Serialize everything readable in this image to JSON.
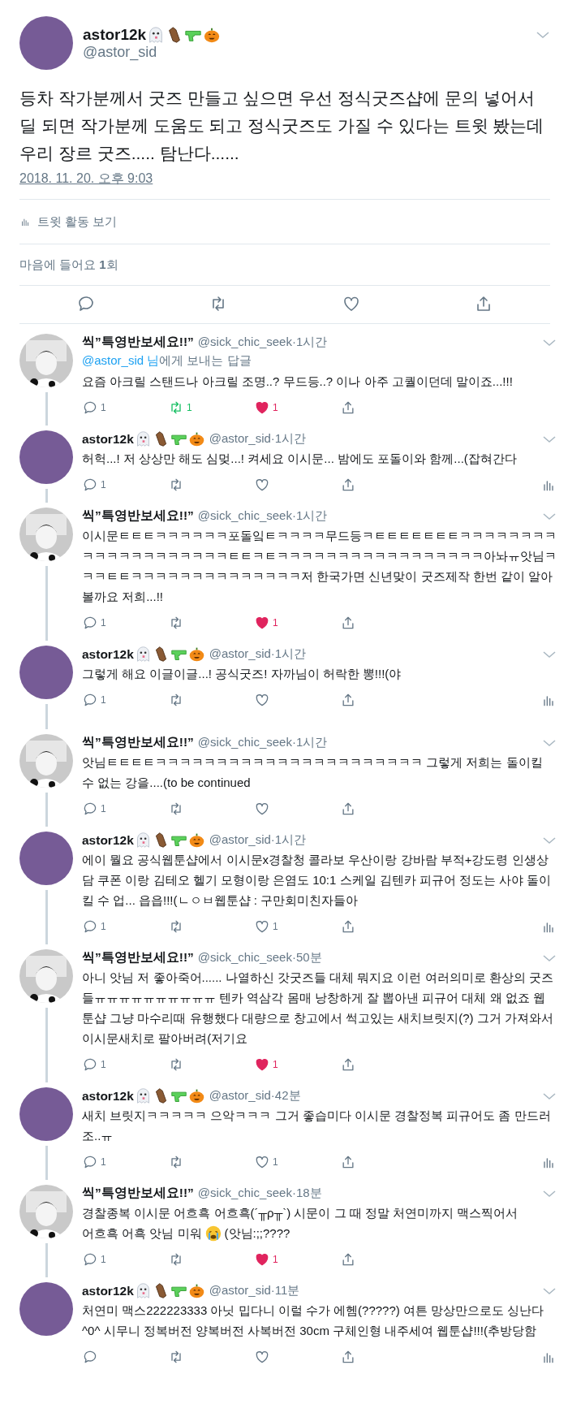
{
  "main_tweet": {
    "name": "astor12k",
    "handle": "@astor_sid",
    "text": "등차 작가분께서 굿즈 만들고 싶으면 우선 정식굿즈샵에 문의 넣어서 딜 되면 작가분께 도움도 되고 정식굿즈도 가질 수 있다는 트윗 봤는데 우리 장르 굿즈..... 탐난다......",
    "timestamp": "2018. 11. 20. 오후 9:03",
    "activity": "트윗 활동 보기",
    "likes": "마음에 들어요 **1**회"
  },
  "replies": [
    {
      "kind": "other",
      "name": "씩”특영반보세요!!”",
      "handle": "@sick_chic_seek",
      "time": "·1시간",
      "reply_to": {
        "link": "@astor_sid 님",
        "text": "에게 보내는 답글"
      },
      "body": "요즘 아크릴 스탠드나 아크릴 조명..? 무드등..? 이나 아주 고퀄이던데 말이죠...!!!",
      "replies": "1",
      "retweets": "1",
      "retweeted": true,
      "likes": "1",
      "liked": true
    },
    {
      "kind": "self",
      "name": "astor12k",
      "handle": "@astor_sid",
      "time": "·1시간",
      "body": "허헉...! 저 상상만 해도 심멎...! 켜세요 이시문... 밤에도 포돌이와 함께...(잡혀간다",
      "replies": "1",
      "retweeted": false,
      "liked": false
    },
    {
      "kind": "other",
      "name": "씩”특영반보세요!!”",
      "handle": "@sick_chic_seek",
      "time": "·1시간",
      "body": "이시문ㅌㅌㅌㅋㅋㅋㅋㅋㅋ포돌잌ㅌㅋㅋㅋㅋ무드등ㅋㅌㅌㅌㅌㅌㅌㅌㅋㅋㅋㅋㅋㅋㅋㅋㅋㅋㅋㅋㅋㅋㅋㅋㅋㅋㅋㅋㅌㅌㅋㅌㅋㅋㅋㅋㅋㅋㅋㅋㅋㅋㅋㅋㅋㅋㅋㅋㅋ아놔ㅠ앗님ㅋㅋㅋㅌㅌㅋㅋㅋㅋㅋㅋㅋㅋㅋㅋㅋㅋㅋㅋ저 한국가면 신년맞이 굿즈제작 한번 같이 알아볼까요 저희...!!",
      "replies": "1",
      "retweeted": false,
      "likes": "1",
      "liked": true
    },
    {
      "kind": "self",
      "name": "astor12k",
      "handle": "@astor_sid",
      "time": "·1시간",
      "body": "그렇게 해요 이글이글...! 공식굿즈! 자까님이 허락한 뽕!!!(야",
      "replies": "1",
      "retweeted": false,
      "liked": false
    },
    {
      "kind": "other",
      "name": "씩”특영반보세요!!”",
      "handle": "@sick_chic_seek",
      "time": "·1시간",
      "body": "앗님ㅌㅌㅌㅌㅋㅋㅋㅋㅋㅋㅋㅋㅋㅋㅋㅋㅋㅋㅋㅋㅋㅋㅋㅋㅋㅋ 그렇게 저희는 돌이킬 수 없는 강을....(to be continued",
      "replies": "1",
      "retweeted": false,
      "liked": false
    },
    {
      "kind": "self",
      "name": "astor12k",
      "handle": "@astor_sid",
      "time": "·1시간",
      "body": "에이 뭘요 공식웹툰샵에서 이시문x경찰청 콜라보 우산이랑 강바람 부적+강도령 인생상담 쿠폰 이랑 김테오 헬기 모형이랑 은염도 10:1 스케일 김텐카 피규어 정도는 사야 돌이킬 수 업... 읍읍!!!(ㄴㅇㅂ웹툰샵 : 구만회미친자들아",
      "replies": "1",
      "retweeted": false,
      "likes": "1",
      "liked": false
    },
    {
      "kind": "other",
      "name": "씩”특영반보세요!!”",
      "handle": "@sick_chic_seek",
      "time": "·50분",
      "body": "아니 앗님 저 좋아죽어...... 나열하신 갓굿즈들 대체 뭐지요 이런 여러의미로 환상의 굿즈들ㅠㅠㅠㅠㅠㅠㅠㅠㅠㅠ 텐카 역삼각 몸매 낭창하게 잘 뽑아낸 피규어 대체 왜 없죠 웹툰샵 그냥 마수리때 유행했다 대량으로 창고에서 썩고있는 새치브릿지(?) 그거 가져와서 이시문새치로 팔아버려(저기요",
      "replies": "1",
      "retweeted": false,
      "likes": "1",
      "liked": true
    },
    {
      "kind": "self",
      "name": "astor12k",
      "handle": "@astor_sid",
      "time": "·42분",
      "body": "새치 브릿지ㅋㅋㅋㅋㅋ 으악ㅋㅋㅋ 그거 좋습미다 이시문 경찰정복 피규어도 좀 만드러조..ㅠ",
      "replies": "1",
      "retweeted": false,
      "likes": "1",
      "liked": false
    },
    {
      "kind": "other",
      "name": "씩”특영반보세요!!”",
      "handle": "@sick_chic_seek",
      "time": "·18분",
      "body": "경찰종복 이시문 어흐흑 어흐흑(´╥ρ╥`) 시문이 그 때 정말 처연미까지 맥스찍어서",
      "emoji_line": {
        "before": "어흐흑 어흑 앗님 미워",
        "after": "(앗님:;;????"
      },
      "replies": "1",
      "retweeted": false,
      "likes": "1",
      "liked": true
    },
    {
      "kind": "self",
      "name": "astor12k",
      "handle": "@astor_sid",
      "time": "·11분",
      "body": "처연미 맥스222223333 아닛 밉다니 이럴 수가 에헴(?????) 여튼 망상만으로도 싱난다^0^ 시무니 정복버전 양복버전 사복버전 30cm 구체인형 내주세여 웹툰샵!!!(추방당함",
      "retweeted": false,
      "liked": false
    }
  ]
}
